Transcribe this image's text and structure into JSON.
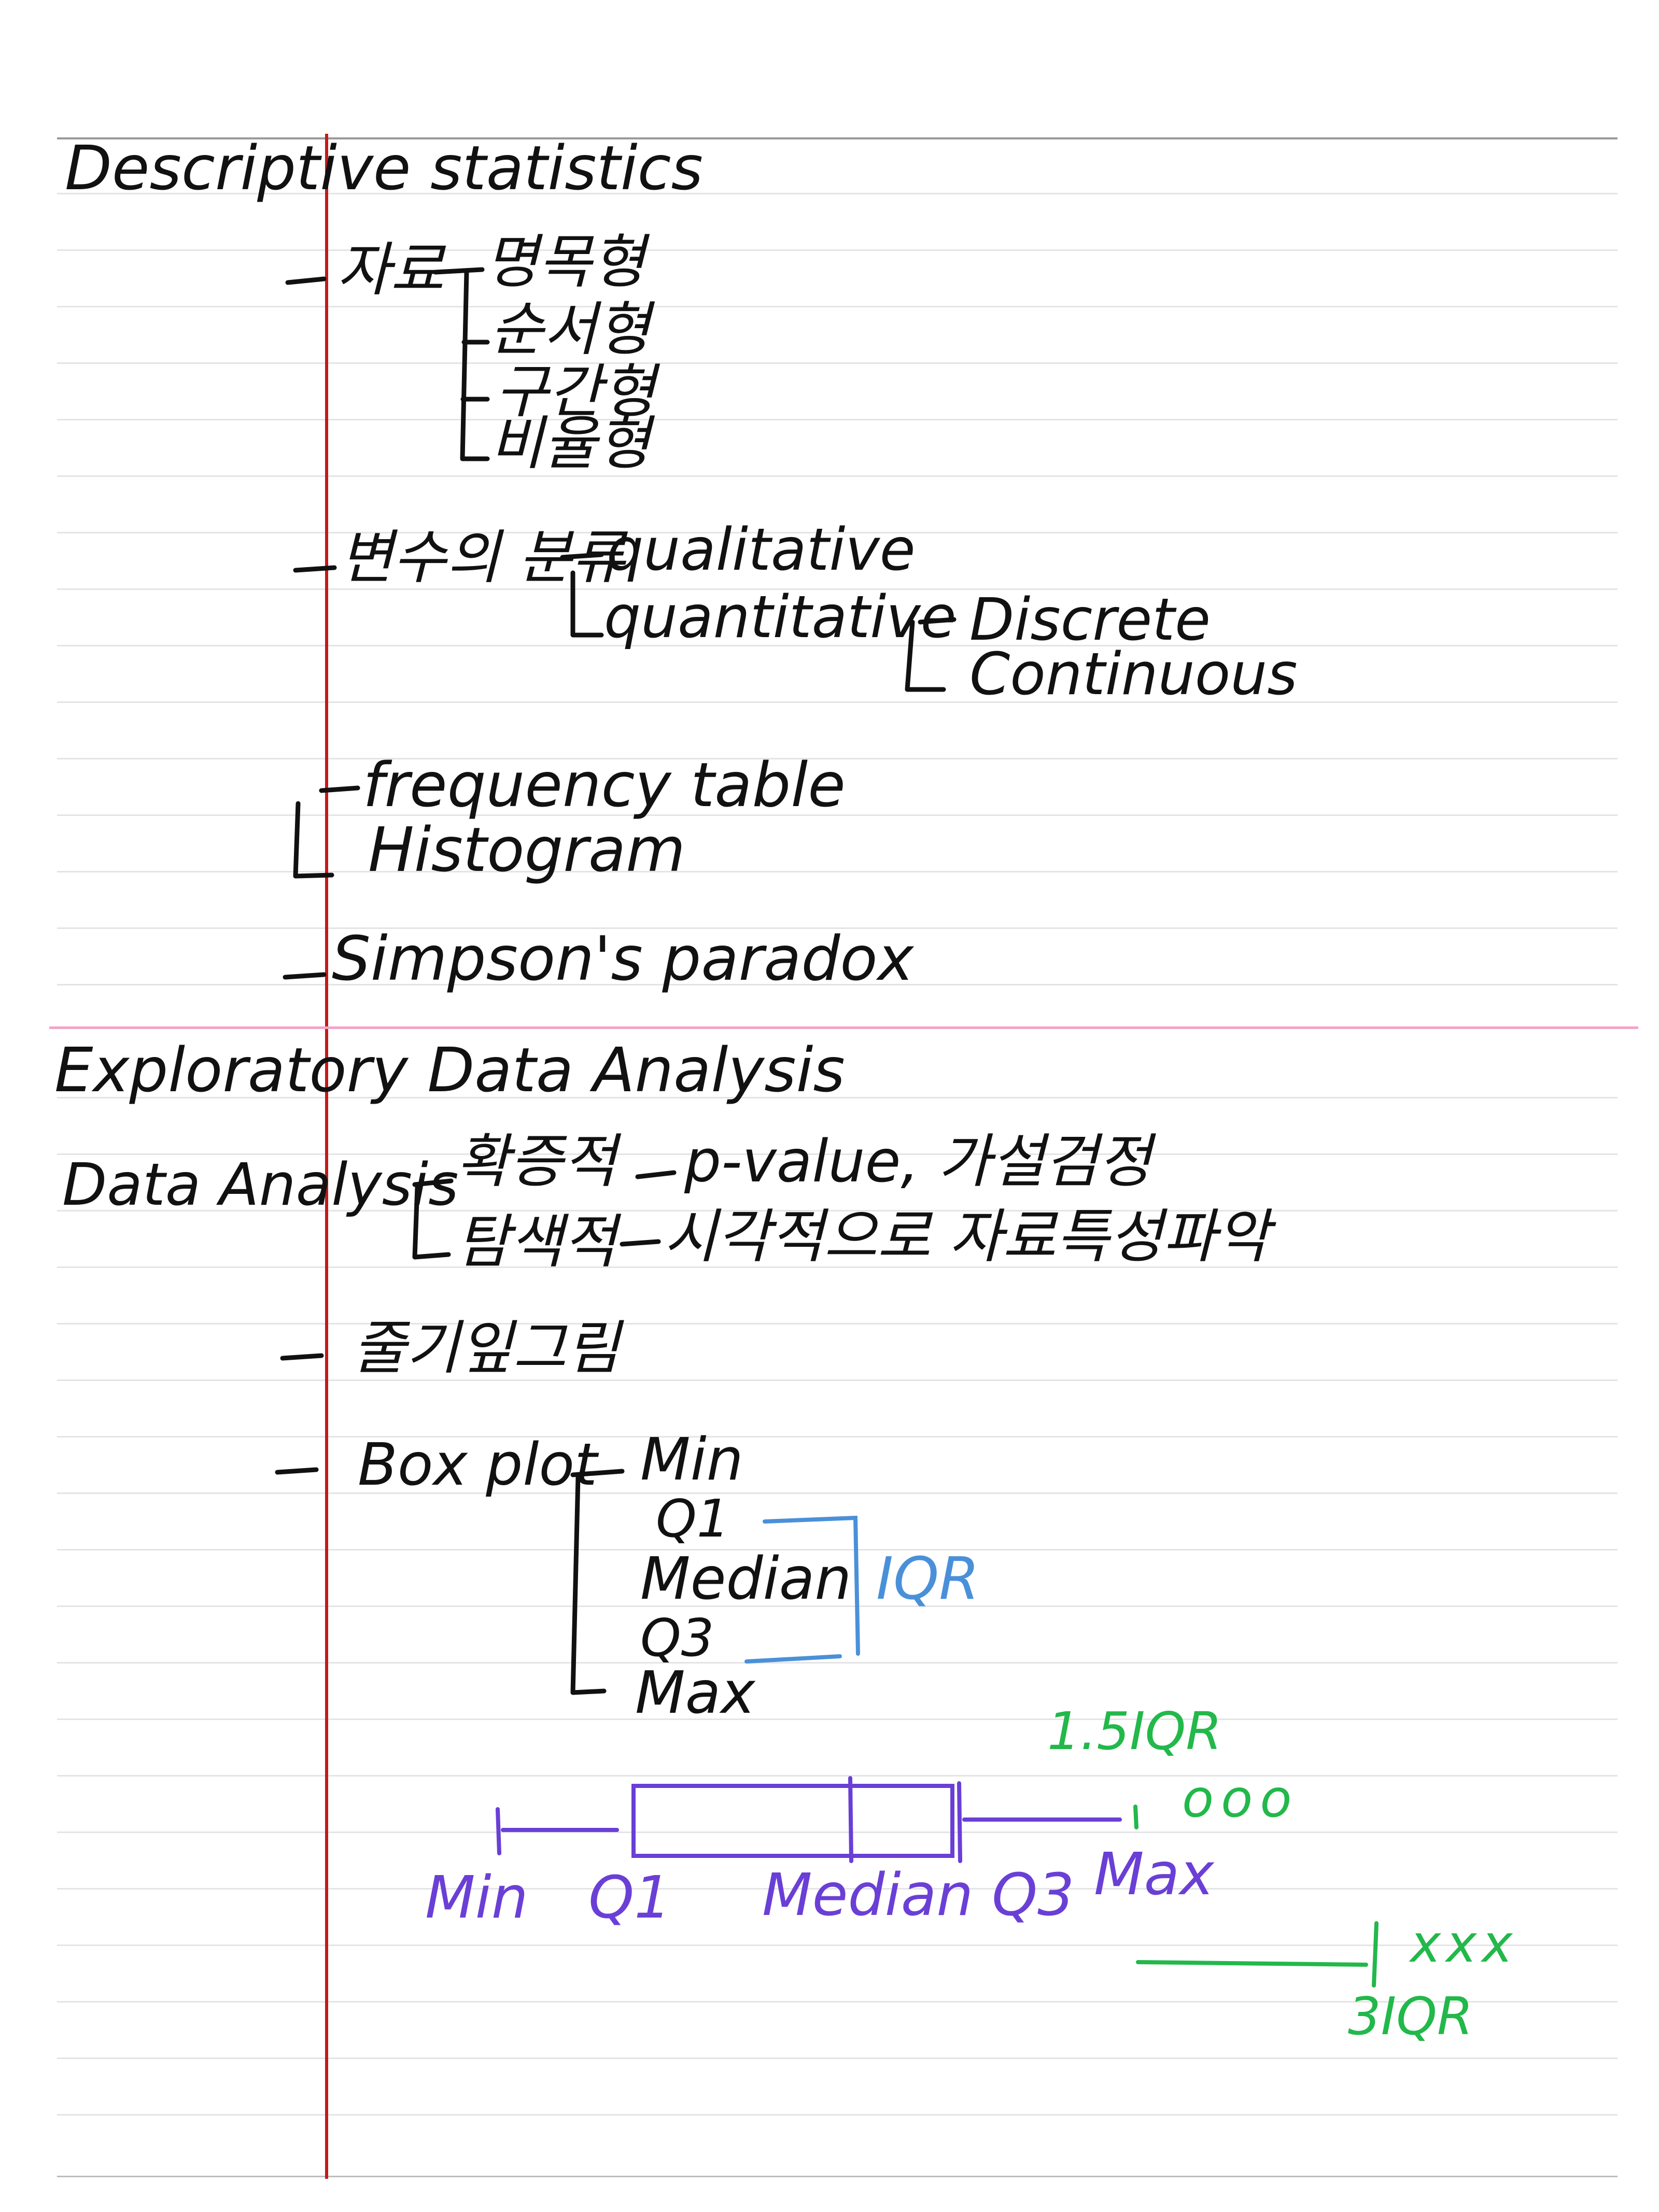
{
  "sections": {
    "descriptive_title": "Descriptive statistics",
    "eda_title": "Exploratory Data Analysis"
  },
  "data_types": {
    "label": "자료",
    "items": [
      "명목형",
      "순서형",
      "구간형",
      "비율형"
    ]
  },
  "variables": {
    "label": "변수의 분류",
    "qualitative": "qualitative",
    "quantitative": "quantitative",
    "discrete": "Discrete",
    "continuous": "Continuous"
  },
  "tables": {
    "frequency": "frequency table",
    "histogram": "Histogram",
    "simpson": "Simpson's paradox"
  },
  "data_analysis": {
    "label": "Data Analysis",
    "confirmatory": "확증적",
    "confirmatory_desc": "p-value, 가설검정",
    "exploratory": "탐색적",
    "exploratory_desc": "시각적으로 자료특성파악"
  },
  "stem_leaf": "줄기잎그림",
  "box_plot": {
    "label": "Box plot",
    "stats": [
      "Min",
      "Q1",
      "Median",
      "Q3",
      "Max"
    ],
    "iqr_label": "IQR"
  },
  "diagram": {
    "min": "Min",
    "q1": "Q1",
    "median_q3": "Median Q3",
    "max": "Max",
    "iqr15": "1.5IQR",
    "iqr3": "3IQR",
    "mild_outliers": "ooo",
    "extreme_outliers": "xxx"
  },
  "colors": {
    "ink": "#111111",
    "margin_red": "#c41a1a",
    "section_pink": "#f2a4c8",
    "iqr_blue": "#4a90d9",
    "box_purple": "#6a3fd6",
    "outlier_green": "#22b84a"
  }
}
